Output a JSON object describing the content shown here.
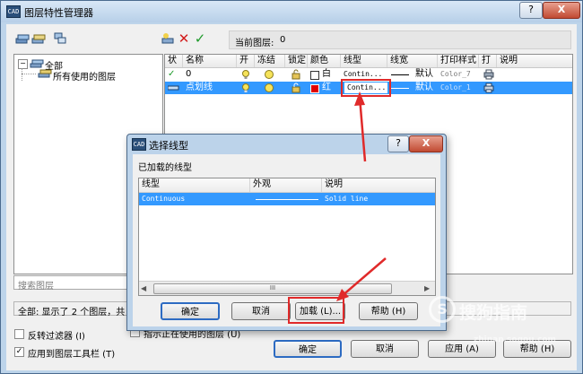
{
  "window": {
    "title": "图层特性管理器",
    "app_icon": "CAD"
  },
  "titlebar_buttons": {
    "help": "?",
    "close": "X"
  },
  "current_layer": {
    "label": "当前图层:",
    "value": "0"
  },
  "tree": {
    "root": "全部",
    "child": "所有使用的图层"
  },
  "layer_table": {
    "headers": [
      "状",
      "名称",
      "开",
      "冻结",
      "锁定",
      "颜色",
      "线型",
      "线宽",
      "打印样式",
      "打",
      "说明"
    ],
    "rows": [
      {
        "status": "✓",
        "name": "0",
        "color": "白",
        "linetype": "Contin...",
        "lineweight": "默认",
        "plot_style": "Color_7"
      },
      {
        "status": "",
        "name": "点划线",
        "color": "红",
        "linetype": "Contin...",
        "lineweight": "默认",
        "plot_style": "Color_1"
      }
    ]
  },
  "search": {
    "placeholder": "搜索图层"
  },
  "status_text": "全部: 显示了 2 个图层，共",
  "checkboxes": {
    "invert_filter": "反转过滤器 (I)",
    "apply_toolbar": "应用到图层工具栏 (T)",
    "show_used": "指示正在使用的图层 (U)"
  },
  "main_buttons": {
    "ok": "确定",
    "cancel": "取消",
    "apply": "应用 (A)",
    "help": "帮助 (H)"
  },
  "dialog": {
    "title": "选择线型",
    "help_button": "?",
    "close_button": "X",
    "group_label": "已加载的线型",
    "headers": [
      "线型",
      "外观",
      "说明"
    ],
    "rows": [
      {
        "name": "Continuous",
        "description": "Solid line"
      }
    ],
    "scroll_thumb": "III",
    "buttons": {
      "ok": "确定",
      "cancel": "取消",
      "load": "加载 (L)...",
      "help": "帮助 (H)"
    }
  },
  "watermark": {
    "brand": "搜狗指南",
    "url": "zhinan.sogou.com",
    "logo_letter": "S"
  },
  "colors": {
    "selection": "#3399ff",
    "red_swatch": "#e00000",
    "annotation_red": "#e02a2a",
    "title_gradient_top": "#d9e8f7"
  }
}
